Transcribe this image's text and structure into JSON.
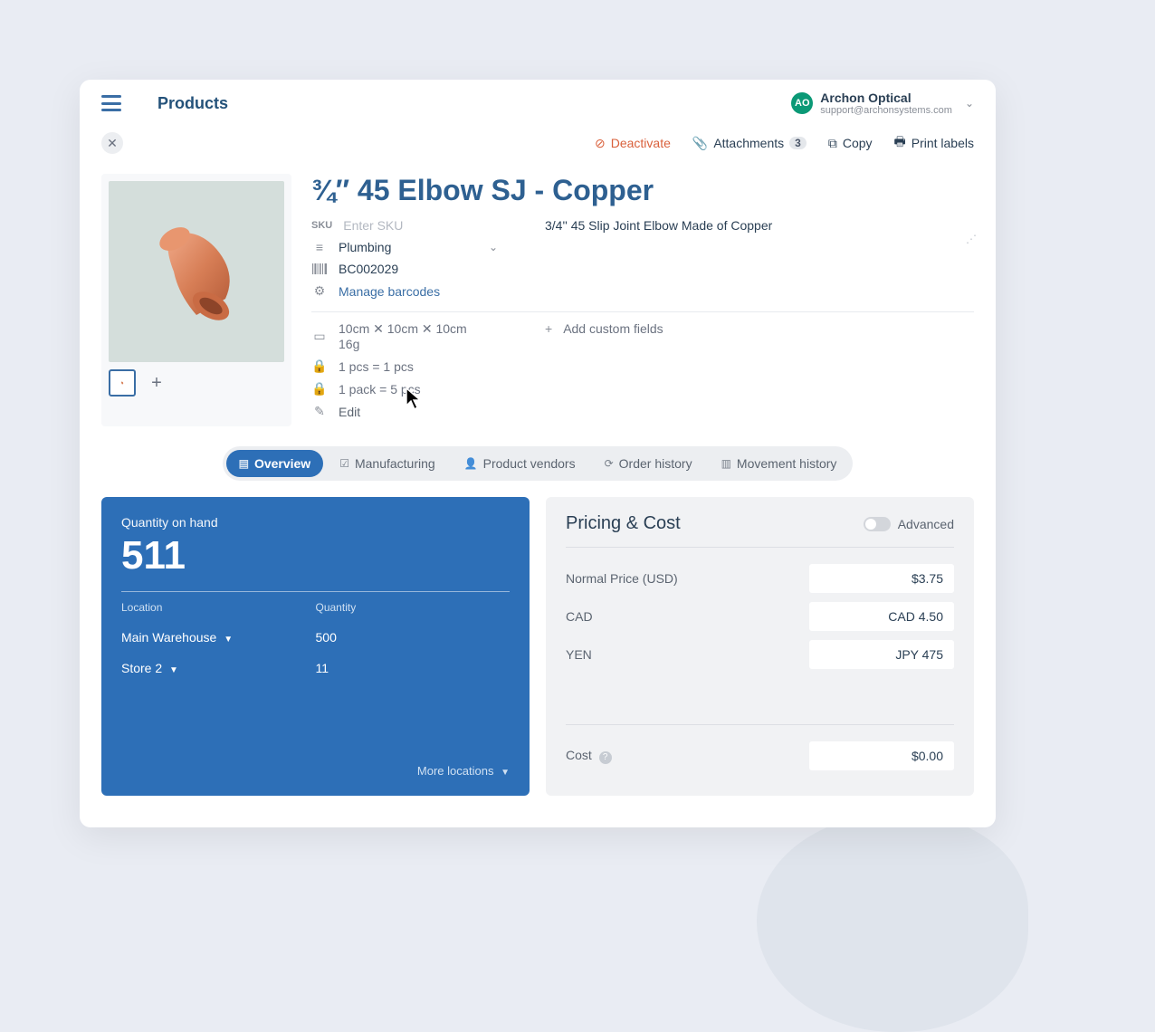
{
  "header": {
    "page_title": "Products",
    "org_name": "Archon Optical",
    "org_email": "support@archonsystems.com",
    "avatar_initials": "AO"
  },
  "toolbar": {
    "deactivate": "Deactivate",
    "attachments": "Attachments",
    "attachments_count": "3",
    "copy": "Copy",
    "print_labels": "Print labels"
  },
  "product": {
    "name": "¾″ 45 Elbow SJ - Copper",
    "sku_label": "SKU",
    "sku_placeholder": "Enter SKU",
    "description": "3/4'' 45 Slip Joint Elbow Made of Copper",
    "category": "Plumbing",
    "barcode": "BC002029",
    "manage_barcodes": "Manage barcodes",
    "dims": "10cm ✕ 10cm ✕ 10cm",
    "weight": "16g",
    "uom1": "1 pcs = 1 pcs",
    "uom2": "1 pack = 5 pcs",
    "edit": "Edit",
    "add_custom_fields": "Add custom fields"
  },
  "tabs": [
    {
      "label": "Overview",
      "icon": "▤"
    },
    {
      "label": "Manufacturing",
      "icon": "☑"
    },
    {
      "label": "Product vendors",
      "icon": "👤"
    },
    {
      "label": "Order history",
      "icon": "⟳"
    },
    {
      "label": "Movement history",
      "icon": "▥"
    }
  ],
  "quantity_panel": {
    "title": "Quantity on hand",
    "total": "511",
    "loc_header": "Location",
    "qty_header": "Quantity",
    "rows": [
      {
        "loc": "Main Warehouse",
        "qty": "500"
      },
      {
        "loc": "Store 2",
        "qty": "11"
      }
    ],
    "more": "More locations"
  },
  "pricing_panel": {
    "title": "Pricing & Cost",
    "advanced_label": "Advanced",
    "rows": [
      {
        "label": "Normal Price (USD)",
        "value": "$3.75"
      },
      {
        "label": "CAD",
        "value": "CAD 4.50"
      },
      {
        "label": "YEN",
        "value": "JPY 475"
      }
    ],
    "cost_label": "Cost",
    "cost_value": "$0.00"
  }
}
